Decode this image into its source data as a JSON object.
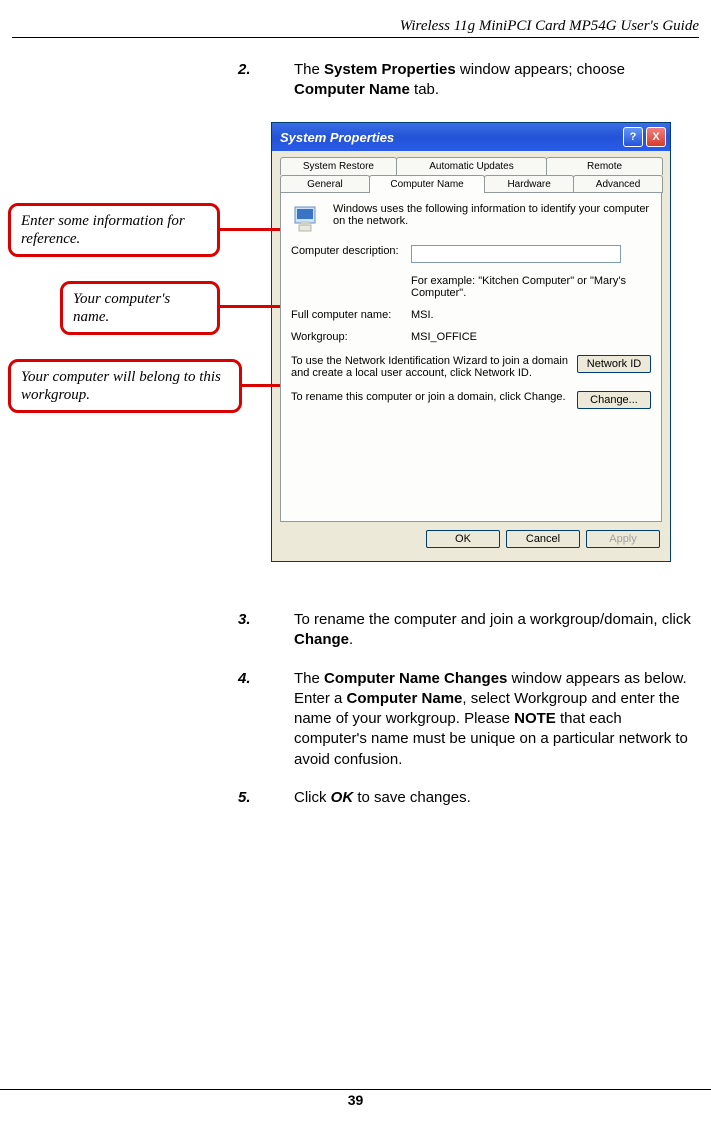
{
  "header": {
    "title": "Wireless 11g MiniPCI Card MP54G User's Guide"
  },
  "steps": {
    "s2": {
      "num": "2.",
      "text_a": "The ",
      "b1": "System Properties",
      "text_b": " window appears; choose ",
      "b2": "Computer Name",
      "text_c": " tab."
    },
    "s3": {
      "num": "3.",
      "text_a": "To rename the computer and join a workgroup/domain, click ",
      "b1": "Change",
      "text_b": "."
    },
    "s4": {
      "num": "4.",
      "text_a": "The ",
      "b1": "Computer Name Changes",
      "text_b": " window appears as below.  Enter a ",
      "b2": "Computer Name",
      "text_c": ", select Workgroup and enter the name of your workgroup.  Please ",
      "b3": "NOTE",
      "text_d": " that each computer's name must be unique on a particular network to avoid confusion."
    },
    "s5": {
      "num": "5.",
      "text_a": "Click ",
      "b1": "OK",
      "text_b": " to save changes."
    }
  },
  "dialog": {
    "title": "System Properties",
    "help": "?",
    "close": "X",
    "tabs_row1": {
      "t1": "System Restore",
      "t2": "Automatic Updates",
      "t3": "Remote"
    },
    "tabs_row2": {
      "t1": "General",
      "t2": "Computer Name",
      "t3": "Hardware",
      "t4": "Advanced"
    },
    "intro": "Windows uses the following information to identify your computer on the network.",
    "desc_label": "Computer description:",
    "desc_value": "",
    "desc_hint": "For example: \"Kitchen Computer\" or \"Mary's Computer\".",
    "fullname_label": "Full computer name:",
    "fullname_value": "MSI.",
    "workgroup_label": "Workgroup:",
    "workgroup_value": "MSI_OFFICE",
    "wizard_text": "To use the Network Identification Wizard to join a domain and create a local user account, click Network ID.",
    "networkid_btn": "Network ID",
    "rename_text": "To rename this computer or join a domain, click Change.",
    "change_btn": "Change...",
    "ok_btn": "OK",
    "cancel_btn": "Cancel",
    "apply_btn": "Apply"
  },
  "callouts": {
    "c1": "Enter some information for reference.",
    "c2": "Your computer's name.",
    "c3": "Your computer will belong to this workgroup."
  },
  "footer": {
    "page": "39"
  }
}
